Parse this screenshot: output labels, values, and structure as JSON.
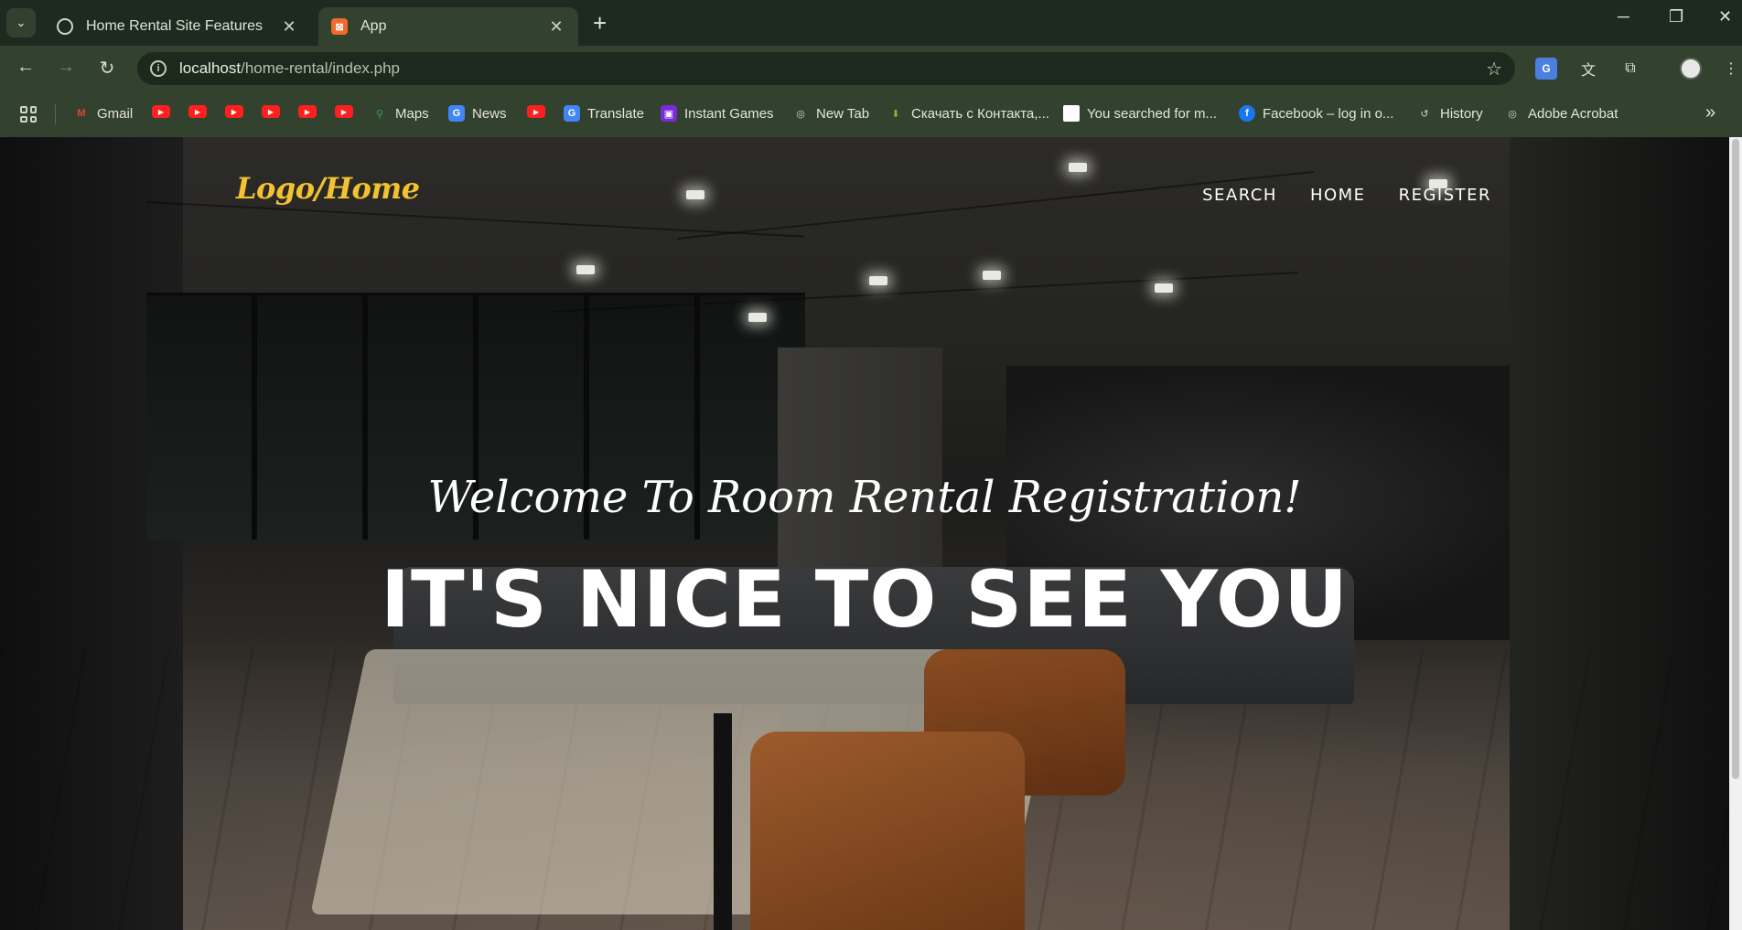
{
  "browser": {
    "tabs": [
      {
        "title": "Home Rental Site Features",
        "favicon": "chatgpt-icon",
        "active": false
      },
      {
        "title": "App",
        "favicon": "xampp-icon",
        "active": true
      }
    ],
    "address": {
      "host": "localhost",
      "path": "/home-rental/index.php"
    },
    "bookmarks": [
      {
        "label": "Gmail",
        "icon": "gmail-icon"
      },
      {
        "label": "",
        "icon": "youtube-icon"
      },
      {
        "label": "",
        "icon": "youtube-icon"
      },
      {
        "label": "",
        "icon": "youtube-icon"
      },
      {
        "label": "",
        "icon": "youtube-icon"
      },
      {
        "label": "",
        "icon": "youtube-icon"
      },
      {
        "label": "",
        "icon": "youtube-icon"
      },
      {
        "label": "Maps",
        "icon": "maps-icon"
      },
      {
        "label": "News",
        "icon": "news-icon"
      },
      {
        "label": "",
        "icon": "youtube-icon"
      },
      {
        "label": "Translate",
        "icon": "translate-icon"
      },
      {
        "label": "Instant Games",
        "icon": "games-icon"
      },
      {
        "label": "New Tab",
        "icon": "globe-icon"
      },
      {
        "label": "Скачать с Контакта,...",
        "icon": "download-icon"
      },
      {
        "label": "You searched for m...",
        "icon": "page-icon"
      },
      {
        "label": "Facebook – log in o...",
        "icon": "facebook-icon"
      },
      {
        "label": "History",
        "icon": "history-icon"
      },
      {
        "label": "Adobe Acrobat",
        "icon": "globe-icon"
      }
    ]
  },
  "site": {
    "logo": "Logo/Home",
    "nav": [
      "SEARCH",
      "HOME",
      "REGISTER"
    ],
    "hero": {
      "subtitle": "Welcome To Room Rental Registration!",
      "title": "IT'S NICE TO SEE YOU"
    }
  },
  "colors": {
    "logo": "#f2c230",
    "chrome_dark": "#1e2a1f",
    "chrome": "#33412f",
    "hero_text": "#ffffff"
  }
}
